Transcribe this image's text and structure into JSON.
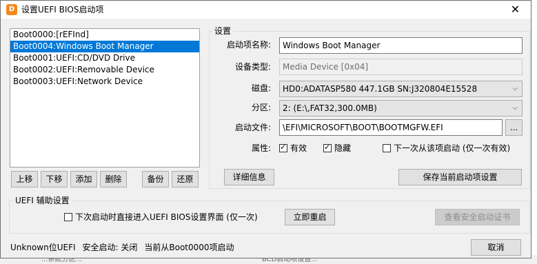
{
  "window": {
    "title": "设置UEFI BIOS启动项",
    "close_glyph": "✕",
    "icon_glyph": "D"
  },
  "boot_list": {
    "items": [
      "Boot0000:[rEFInd]",
      "Boot0004:Windows Boot Manager",
      "Boot0001:UEFI:CD/DVD Drive",
      "Boot0002:UEFI:Removable Device",
      "Boot0003:UEFI:Network Device"
    ],
    "selected_index": 1
  },
  "list_buttons": {
    "up": "上移",
    "down": "下移",
    "add": "添加",
    "delete": "删除",
    "backup": "备份",
    "restore": "还原"
  },
  "settings": {
    "caption": "设置",
    "name_label": "启动项名称:",
    "name_value": "Windows Boot Manager",
    "device_type_label": "设备类型:",
    "device_type_value": "Media Device [0x04]",
    "disk_label": "磁盘:",
    "disk_value": "HD0:ADATASP580 447.1GB SN:J320804E15528",
    "partition_label": "分区:",
    "partition_value": "2: (E:\\,FAT32,300.0MB)",
    "boot_file_label": "启动文件:",
    "boot_file_value": "\\EFI\\MICROSOFT\\BOOT\\BOOTMGFW.EFI",
    "browse_label": "...",
    "attributes_label": "属性:",
    "attr_active": {
      "label": "有效",
      "checked": true
    },
    "attr_hidden": {
      "label": "隐藏",
      "checked": true
    },
    "attr_next_once": {
      "label": "下一次从该项启动 (仅一次有效)",
      "checked": false
    },
    "details_button": "详细信息",
    "save_button": "保存当前启动项设置"
  },
  "uefi_aux": {
    "caption": "UEFI 辅助设置",
    "enter_bios_next": {
      "label": "下次启动时直接进入UEFI BIOS设置界面 (仅一次)",
      "checked": false
    },
    "restart_button": "立即重启",
    "secure_cert_button": "查看安全启动证书"
  },
  "status_bar": {
    "bitness": "Unknown位UEFI",
    "secure_boot": "安全启动: 关闭",
    "current_boot": "当前从Boot0000项启动"
  },
  "cancel_button": "取消",
  "background_peek": {
    "left": "...系统分区...",
    "right": "BCD启动项设置..."
  },
  "colors": {
    "selection": "#0078d7",
    "dialog_bg": "#f0f0f0",
    "title_icon": "#f08a1c"
  }
}
